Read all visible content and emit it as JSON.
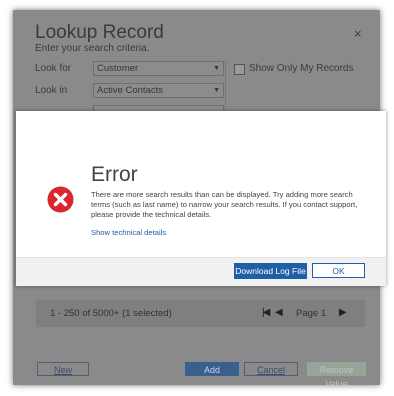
{
  "lookup": {
    "title": "Lookup Record",
    "subtitle": "Enter your search criteria.",
    "close_glyph": "×",
    "look_for_label": "Look for",
    "look_for_value": "Customer",
    "look_in_label": "Look in",
    "look_in_value": "Active Contacts",
    "only_my_records_label": "Show Only My Records",
    "only_my_records_checked": false,
    "pager": {
      "count_text": "1 - 250 of 5000+ (1 selected)",
      "page_text": "Page 1"
    },
    "buttons": {
      "new": "New",
      "add": "Add",
      "cancel": "Cancel",
      "remove": "Remove Value"
    }
  },
  "error": {
    "title": "Error",
    "message": "There are more search results than can be displayed. Try adding more search terms (such as last name) to narrow your search results. If you contact support, please provide the technical details.",
    "details_link": "Show technical details",
    "download_button": "Download Log File",
    "ok_button": "OK",
    "icon": "error-x-icon"
  },
  "colors": {
    "accent": "#1f5fa8",
    "error_red": "#d9262f",
    "overlay_gray": "#8a8a8a"
  }
}
